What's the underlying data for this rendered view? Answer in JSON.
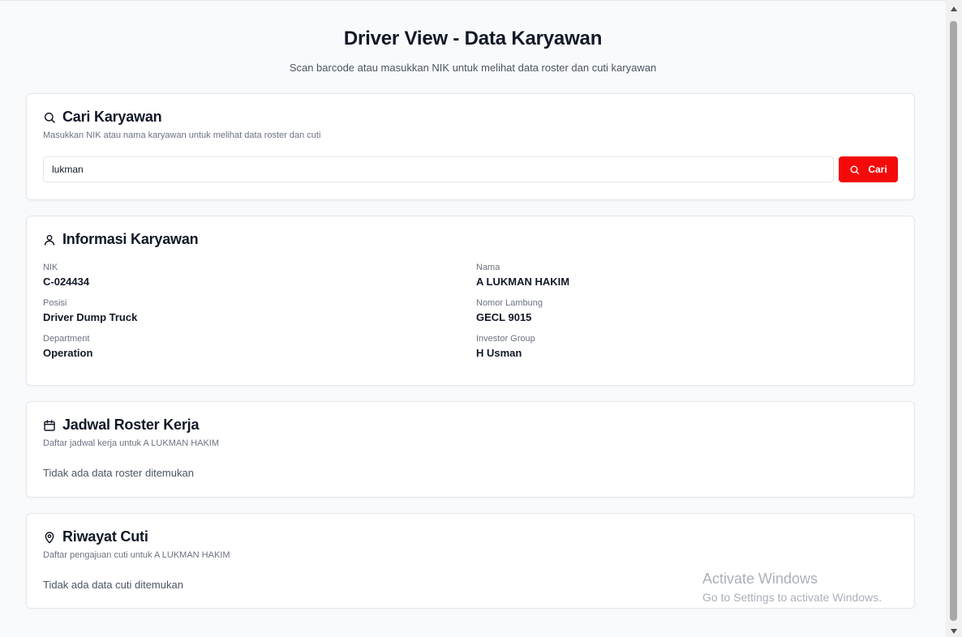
{
  "header": {
    "title": "Driver View - Data Karyawan",
    "subtitle": "Scan barcode atau masukkan NIK untuk melihat data roster dan cuti karyawan"
  },
  "search_card": {
    "icon": "search-icon",
    "title": "Cari Karyawan",
    "description": "Masukkan NIK atau nama karyawan untuk melihat data roster dan cuti",
    "input_value": "lukman",
    "button_label": "Cari",
    "button_color": "#f40a0a"
  },
  "info_card": {
    "icon": "user-icon",
    "title": "Informasi Karyawan",
    "fields": [
      {
        "label": "NIK",
        "value": "C-024434"
      },
      {
        "label": "Nama",
        "value": "A LUKMAN HAKIM"
      },
      {
        "label": "Posisi",
        "value": "Driver Dump Truck"
      },
      {
        "label": "Nomor Lambung",
        "value": "GECL 9015"
      },
      {
        "label": "Department",
        "value": "Operation"
      },
      {
        "label": "Investor Group",
        "value": "H Usman"
      }
    ]
  },
  "roster_card": {
    "icon": "calendar-icon",
    "title": "Jadwal Roster Kerja",
    "description": "Daftar jadwal kerja untuk A LUKMAN HAKIM",
    "empty_text": "Tidak ada data roster ditemukan"
  },
  "leave_card": {
    "icon": "map-pin-icon",
    "title": "Riwayat Cuti",
    "description": "Daftar pengajuan cuti untuk A LUKMAN HAKIM",
    "empty_text": "Tidak ada data cuti ditemukan"
  },
  "watermark": {
    "title": "Activate Windows",
    "subtitle": "Go to Settings to activate Windows."
  }
}
